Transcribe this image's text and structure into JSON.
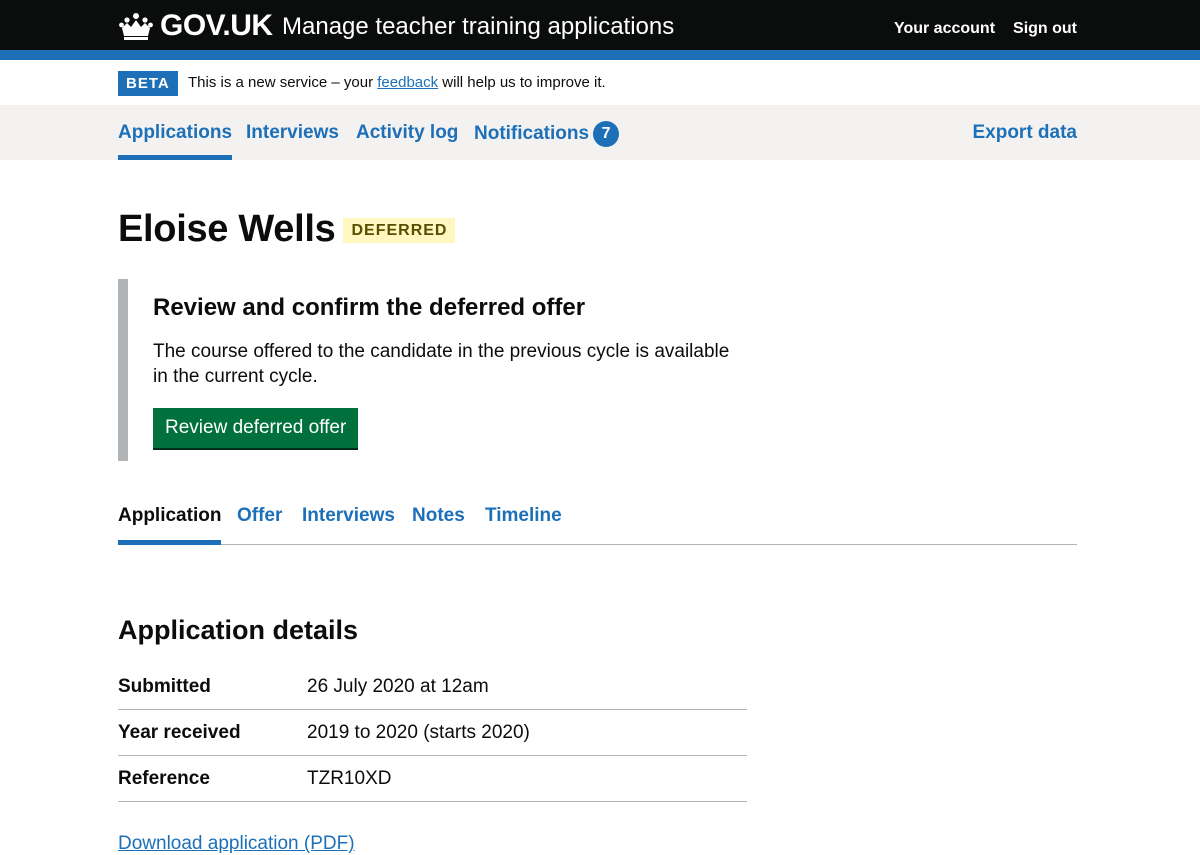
{
  "header": {
    "logo_text": "GOV.UK",
    "service_name": "Manage teacher training applications",
    "links": [
      "Your account",
      "Sign out"
    ]
  },
  "phase_banner": {
    "tag": "BETA",
    "text_before": "This is a new service – your ",
    "link_text": "feedback",
    "text_after": " will help us to improve it."
  },
  "primary_nav": {
    "items": [
      "Applications",
      "Interviews",
      "Activity log",
      "Notifications"
    ],
    "active": "Applications",
    "notifications_count": "7",
    "export_label": "Export data"
  },
  "page": {
    "title": "Eloise Wells",
    "status": "DEFERRED"
  },
  "inset": {
    "heading": "Review and confirm the deferred offer",
    "body": "The course offered to the candidate in the previous cycle is available in the current cycle.",
    "button": "Review deferred offer"
  },
  "sub_nav": {
    "items": [
      "Application",
      "Offer",
      "Interviews",
      "Notes",
      "Timeline"
    ],
    "active": "Application"
  },
  "details": {
    "heading": "Application details",
    "rows": [
      {
        "key": "Submitted",
        "value": "26 July 2020 at 12am"
      },
      {
        "key": "Year received",
        "value": "2019 to 2020 (starts 2020)"
      },
      {
        "key": "Reference",
        "value": "TZR10XD"
      }
    ]
  },
  "download_link": "Download application (PDF)",
  "colors": {
    "header_bg": "#0b0c0c",
    "brand_blue": "#1d70b8",
    "button_green": "#00703c",
    "nav_bg": "#f3f2f1",
    "tag_yellow_bg": "#fff7bf",
    "tag_yellow_text": "#594d00"
  }
}
